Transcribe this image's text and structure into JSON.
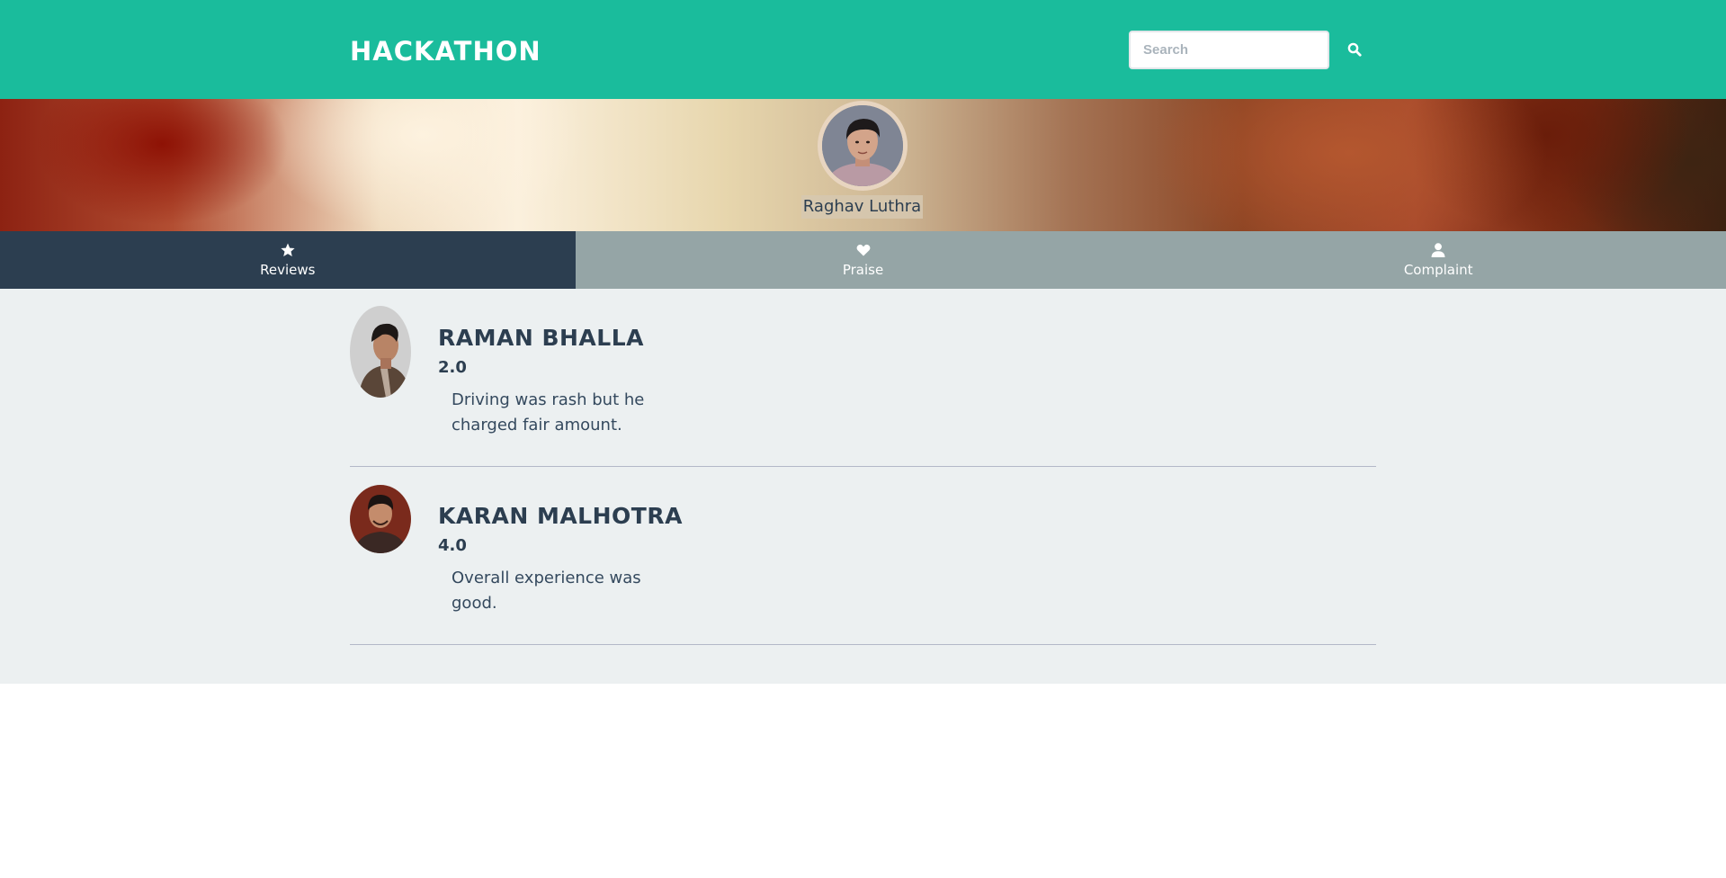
{
  "navbar": {
    "brand": "HACKATHON",
    "search": {
      "placeholder": "Search",
      "icon": "search-icon"
    }
  },
  "profile": {
    "name": "Raghav Luthra"
  },
  "tabs": [
    {
      "label": "Reviews",
      "icon": "star-icon",
      "active": true
    },
    {
      "label": "Praise",
      "icon": "heart-icon",
      "active": false
    },
    {
      "label": "Complaint",
      "icon": "user-icon",
      "active": false
    }
  ],
  "reviews": [
    {
      "name": "RAMAN BHALLA",
      "rating": "2.0",
      "text": "Driving was rash but he charged fair amount."
    },
    {
      "name": "KARAN MALHOTRA",
      "rating": "4.0",
      "text": "Overall experience was good."
    }
  ],
  "colors": {
    "navbar": "#1abc9c",
    "tab_active": "#2c3e50",
    "tab_inactive": "#95a5a6",
    "content_bg": "#ecf0f1",
    "text_dark": "#2c3e50"
  }
}
